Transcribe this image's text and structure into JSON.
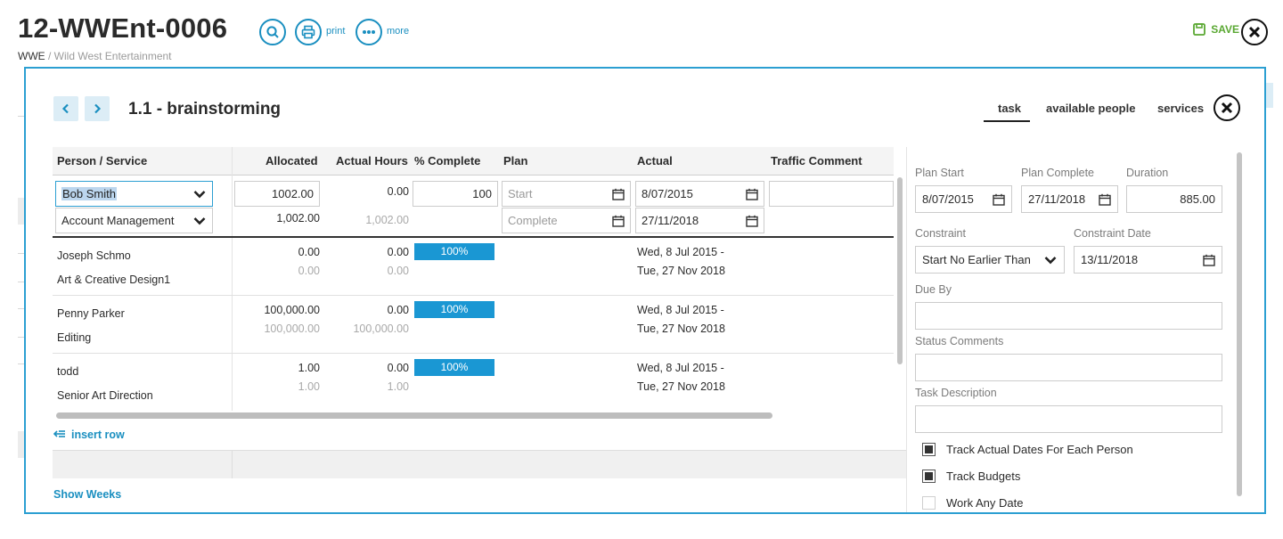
{
  "header": {
    "job_number": "12-WWEnt-0006",
    "client_code": "WWE",
    "client_sep": " / ",
    "client_name": "Wild West Entertainment",
    "print_label": "print",
    "more_label": "more",
    "save_label": "SAVE"
  },
  "task": {
    "title": "1.1 - brainstorming",
    "tabs": [
      {
        "label": "task",
        "active": true
      },
      {
        "label": "available people",
        "active": false
      },
      {
        "label": "services",
        "active": false
      }
    ]
  },
  "grid": {
    "columns": [
      "Person / Service",
      "Allocated",
      "Actual Hours",
      "% Complete",
      "Plan",
      "Actual",
      "Traffic Comment"
    ],
    "edit_row": {
      "person": "Bob Smith",
      "service": "Account Management",
      "allocated_input": "1002.00",
      "actual_hours": "0.00",
      "percent_input": "100",
      "plan_start_placeholder": "Start",
      "plan_complete_placeholder": "Complete",
      "actual_start": "8/07/2015",
      "actual_complete": "27/11/2018",
      "allocated_total": "1,002.00",
      "actual_total": "1,002.00"
    },
    "rows": [
      {
        "person": "Joseph Schmo",
        "service": "Art & Creative Design1",
        "allocated": "0.00",
        "allocated_sub": "0.00",
        "actual": "0.00",
        "actual_sub": "0.00",
        "complete": "100%",
        "complete_value": 100,
        "dates_1": "Wed, 8 Jul 2015 -",
        "dates_2": "Tue, 27 Nov 2018"
      },
      {
        "person": "Penny Parker",
        "service": "Editing",
        "allocated": "100,000.00",
        "allocated_sub": "100,000.00",
        "actual": "0.00",
        "actual_sub": "100,000.00",
        "complete": "100%",
        "complete_value": 100,
        "dates_1": "Wed, 8 Jul 2015 -",
        "dates_2": "Tue, 27 Nov 2018"
      },
      {
        "person": "todd",
        "service": "Senior Art Direction",
        "allocated": "1.00",
        "allocated_sub": "1.00",
        "actual": "0.00",
        "actual_sub": "1.00",
        "complete": "100%",
        "complete_value": 100,
        "dates_1": "Wed, 8 Jul 2015 -",
        "dates_2": "Tue, 27 Nov 2018"
      }
    ],
    "insert_row_label": "insert row",
    "show_weeks_label": "Show Weeks"
  },
  "panel": {
    "plan_start_label": "Plan Start",
    "plan_start": "8/07/2015",
    "plan_complete_label": "Plan Complete",
    "plan_complete": "27/11/2018",
    "duration_label": "Duration",
    "duration": "885.00",
    "constraint_label": "Constraint",
    "constraint": "Start No Earlier Than",
    "constraint_date_label": "Constraint Date",
    "constraint_date": "13/11/2018",
    "due_by_label": "Due By",
    "due_by": "",
    "status_comments_label": "Status Comments",
    "status_comments": "",
    "task_description_label": "Task Description",
    "task_description": "",
    "checkboxes": [
      {
        "label": "Track Actual Dates For Each Person",
        "checked": true
      },
      {
        "label": "Track Budgets",
        "checked": true
      },
      {
        "label": "Work Any Date",
        "checked": false
      }
    ]
  },
  "colors": {
    "accent": "#1a8fc0",
    "modal_border": "#2c9fd2",
    "progress": "#1a97d3",
    "save": "#5aa832"
  }
}
